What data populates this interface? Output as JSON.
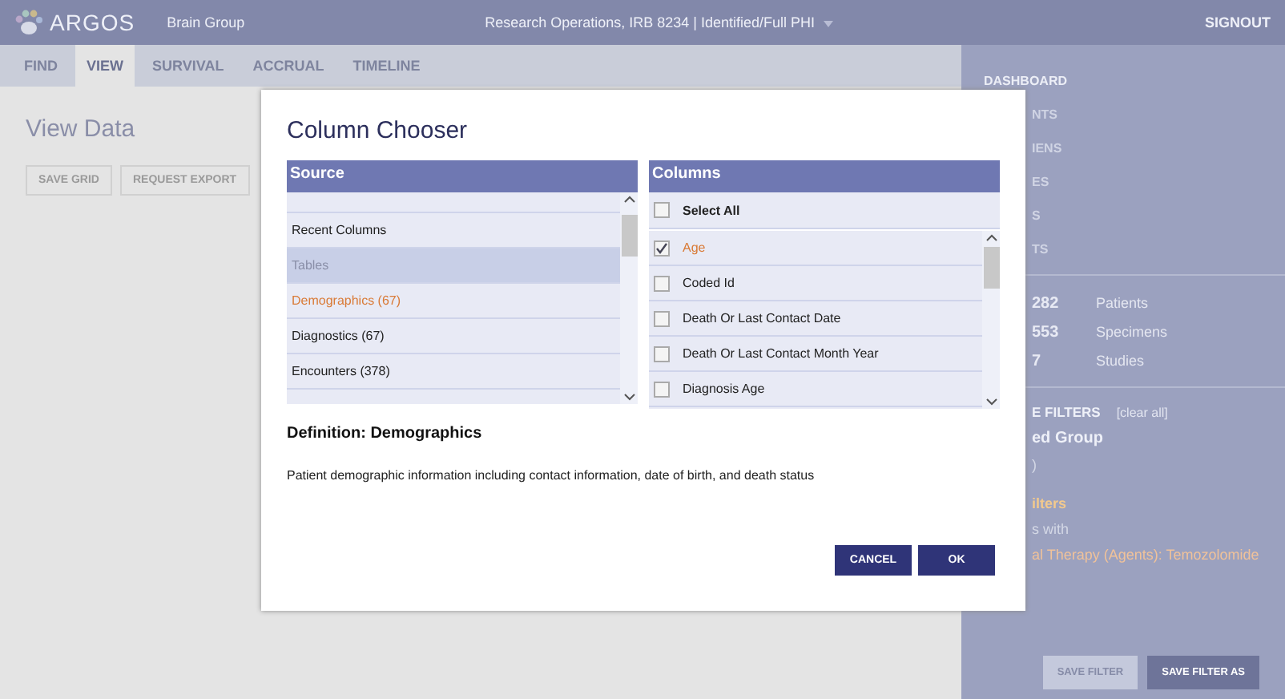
{
  "header": {
    "logo": "ARGOS",
    "group": "Brain Group",
    "project": "Research Operations, IRB 8234 | Identified/Full PHI",
    "signout": "SIGNOUT"
  },
  "tabs": [
    {
      "label": "FIND",
      "selected": false
    },
    {
      "label": "VIEW",
      "selected": true
    },
    {
      "label": "SURVIVAL",
      "selected": false
    },
    {
      "label": "ACCRUAL",
      "selected": false
    },
    {
      "label": "TIMELINE",
      "selected": false
    }
  ],
  "main": {
    "title": "View Data",
    "buttons": [
      {
        "label": "SAVE GRID",
        "disabled": true
      },
      {
        "label": "REQUEST EXPORT",
        "disabled": true
      }
    ]
  },
  "sidebar": {
    "nav": [
      "DASHBOARD",
      "NTS",
      "IENS",
      "ES",
      "S",
      "TS"
    ],
    "counts": [
      {
        "value": "282",
        "label": "Patients"
      },
      {
        "value": "553",
        "label": "Specimens"
      },
      {
        "value": "7",
        "label": "Studies"
      }
    ],
    "filters_heading": "E FILTERS",
    "clear": "[clear all]",
    "filters": [
      {
        "kind": "group",
        "text": "ed Group"
      },
      {
        "kind": "plain",
        "text": ")"
      },
      {
        "kind": "heading",
        "text": "ilters"
      },
      {
        "kind": "plain",
        "text": "s with"
      },
      {
        "kind": "value",
        "text": "al Therapy (Agents): Temozolomide"
      }
    ],
    "buttons": [
      {
        "label": "SAVE FILTER",
        "disabled": true
      },
      {
        "label": "SAVE FILTER AS",
        "disabled": false
      }
    ]
  },
  "dialog": {
    "title": "Column Chooser",
    "source": {
      "heading": "Source",
      "items": [
        {
          "kind": "item",
          "label": "Recent Columns",
          "selected": false
        },
        {
          "kind": "group",
          "label": "Tables",
          "selected": false
        },
        {
          "kind": "item",
          "label": "Demographics (67)",
          "selected": true
        },
        {
          "kind": "item",
          "label": "Diagnostics (67)",
          "selected": false
        },
        {
          "kind": "item",
          "label": "Encounters (378)",
          "selected": false
        }
      ]
    },
    "columns": {
      "heading": "Columns",
      "select_all": {
        "label": "Select All",
        "checked": false
      },
      "items": [
        {
          "label": "Age",
          "checked": true
        },
        {
          "label": "Coded Id",
          "checked": false
        },
        {
          "label": "Death Or Last Contact Date",
          "checked": false
        },
        {
          "label": "Death Or Last Contact Month Year",
          "checked": false
        },
        {
          "label": "Diagnosis Age",
          "checked": false
        }
      ]
    },
    "definition_title": "Definition: Demographics",
    "definition": "Patient demographic information including contact information, date of birth, and death status",
    "buttons": [
      "CANCEL",
      "OK"
    ]
  }
}
